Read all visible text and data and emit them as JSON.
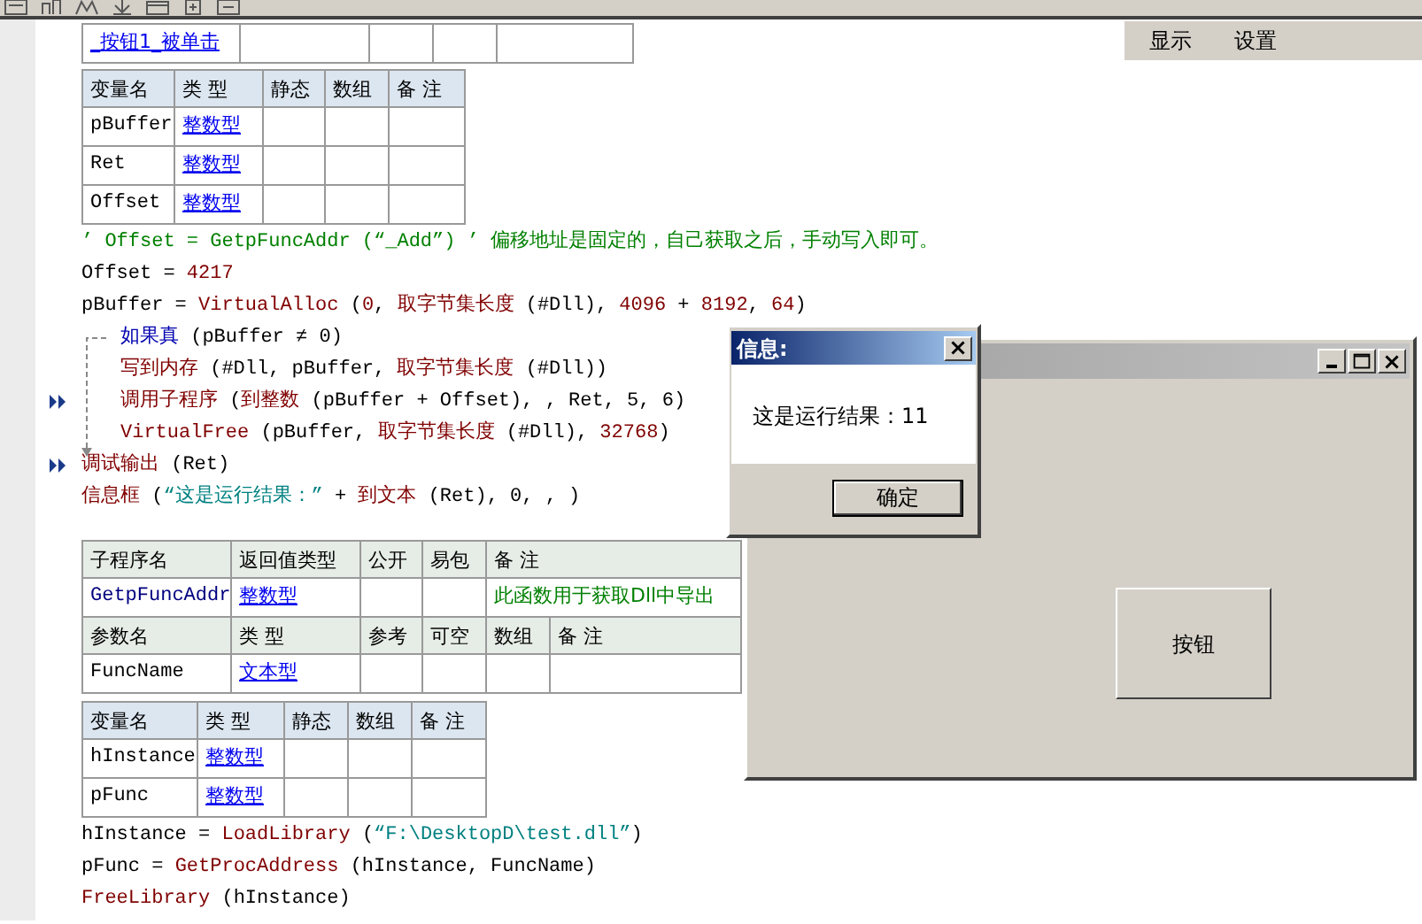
{
  "menu": [
    {
      "label": "显示"
    },
    {
      "label": "设置"
    }
  ],
  "event": {
    "name": "_按钮1_被单击"
  },
  "locals_1": {
    "columns": [
      "变量名",
      "类 型",
      "静态",
      "数组",
      "备 注"
    ],
    "rows": [
      {
        "name": "pBuffer",
        "type": "整数型"
      },
      {
        "name": "Ret",
        "type": "整数型"
      },
      {
        "name": "Offset",
        "type": "整数型"
      }
    ]
  },
  "code_1": [
    {
      "kind": "line",
      "marked": false,
      "tokens": [
        {
          "text": "’ Offset = GetpFuncAddr (“_Add”) ’ 偏移地址是固定的，自己获取之后，手动写入即可。",
          "kind": "comment"
        }
      ]
    },
    {
      "kind": "line",
      "marked": false,
      "tokens": [
        {
          "text": "Offset = ",
          "kind": "plain"
        },
        {
          "text": "4217",
          "kind": "number"
        }
      ]
    },
    {
      "kind": "line",
      "marked": false,
      "tokens": [
        {
          "text": "pBuffer = ",
          "kind": "plain"
        },
        {
          "text": "VirtualAlloc",
          "kind": "func"
        },
        {
          "text": " (",
          "kind": "plain"
        },
        {
          "text": "0",
          "kind": "number"
        },
        {
          "text": ", ",
          "kind": "plain"
        },
        {
          "text": "取字节集长度",
          "kind": "func"
        },
        {
          "text": " (#Dll), ",
          "kind": "plain"
        },
        {
          "text": "4096",
          "kind": "number"
        },
        {
          "text": " + ",
          "kind": "plain"
        },
        {
          "text": "8192",
          "kind": "number"
        },
        {
          "text": ", ",
          "kind": "plain"
        },
        {
          "text": "64",
          "kind": "number"
        },
        {
          "text": ")",
          "kind": "plain"
        }
      ]
    },
    {
      "kind": "block",
      "marked": false,
      "tokens": [
        {
          "text": "如果真",
          "kind": "keyword"
        },
        {
          "text": " (pBuffer ≠ 0)",
          "kind": "plain"
        }
      ],
      "children": [
        {
          "kind": "line",
          "marked": false,
          "tokens": [
            {
              "text": "写到内存",
              "kind": "func"
            },
            {
              "text": " (#Dll, pBuffer, ",
              "kind": "plain"
            },
            {
              "text": "取字节集长度",
              "kind": "func"
            },
            {
              "text": " (#Dll))",
              "kind": "plain"
            }
          ]
        },
        {
          "kind": "line",
          "marked": true,
          "tokens": [
            {
              "text": "调用子程序",
              "kind": "func"
            },
            {
              "text": " (",
              "kind": "plain"
            },
            {
              "text": "到整数",
              "kind": "func"
            },
            {
              "text": " (pBuffer + Offset), , Ret, 5, 6)",
              "kind": "plain"
            }
          ]
        },
        {
          "kind": "line",
          "marked": false,
          "tokens": [
            {
              "text": "VirtualFree",
              "kind": "func"
            },
            {
              "text": " (pBuffer, ",
              "kind": "plain"
            },
            {
              "text": "取字节集长度",
              "kind": "func"
            },
            {
              "text": " (#Dll), ",
              "kind": "plain"
            },
            {
              "text": "32768",
              "kind": "number"
            },
            {
              "text": ")",
              "kind": "plain"
            }
          ]
        }
      ]
    },
    {
      "kind": "line",
      "marked": true,
      "tokens": [
        {
          "text": "调试输出",
          "kind": "func"
        },
        {
          "text": " (Ret)",
          "kind": "plain"
        }
      ]
    },
    {
      "kind": "line",
      "marked": false,
      "tokens": [
        {
          "text": "信息框",
          "kind": "func"
        },
        {
          "text": " (",
          "kind": "plain"
        },
        {
          "text": "“这是运行结果：”",
          "kind": "string"
        },
        {
          "text": " + ",
          "kind": "plain"
        },
        {
          "text": "到文本",
          "kind": "func"
        },
        {
          "text": " (Ret), 0, , )",
          "kind": "plain"
        }
      ]
    }
  ],
  "subroutine": {
    "columns": [
      "子程序名",
      "返回值类型",
      "公开",
      "易包",
      "备 注"
    ],
    "name": "GetpFuncAddr",
    "return_type": "整数型",
    "remark": "此函数用于获取Dll中导出"
  },
  "params": {
    "columns": [
      "参数名",
      "类 型",
      "参考",
      "可空",
      "数组",
      "备 注"
    ],
    "rows": [
      {
        "name": "FuncName",
        "type": "文本型"
      }
    ]
  },
  "locals_2": {
    "columns": [
      "变量名",
      "类 型",
      "静态",
      "数组",
      "备 注"
    ],
    "rows": [
      {
        "name": "hInstance",
        "type": "整数型"
      },
      {
        "name": "pFunc",
        "type": "整数型"
      }
    ]
  },
  "code_2": [
    {
      "kind": "line",
      "marked": false,
      "tokens": [
        {
          "text": "hInstance = ",
          "kind": "plain"
        },
        {
          "text": "LoadLibrary",
          "kind": "func"
        },
        {
          "text": " (",
          "kind": "plain"
        },
        {
          "text": "“F:\\DesktopD\\test.dll”",
          "kind": "string"
        },
        {
          "text": ")",
          "kind": "plain"
        }
      ]
    },
    {
      "kind": "line",
      "marked": false,
      "tokens": [
        {
          "text": "pFunc = ",
          "kind": "plain"
        },
        {
          "text": "GetProcAddress",
          "kind": "func"
        },
        {
          "text": " (hInstance, FuncName)",
          "kind": "plain"
        }
      ]
    },
    {
      "kind": "line",
      "marked": false,
      "tokens": [
        {
          "text": "FreeLibrary",
          "kind": "func"
        },
        {
          "text": " (hInstance)",
          "kind": "plain"
        }
      ]
    }
  ],
  "form_window": {
    "button": "按钮"
  },
  "message_box": {
    "title": "信息:",
    "message": "这是运行结果：11",
    "button": "确定"
  }
}
